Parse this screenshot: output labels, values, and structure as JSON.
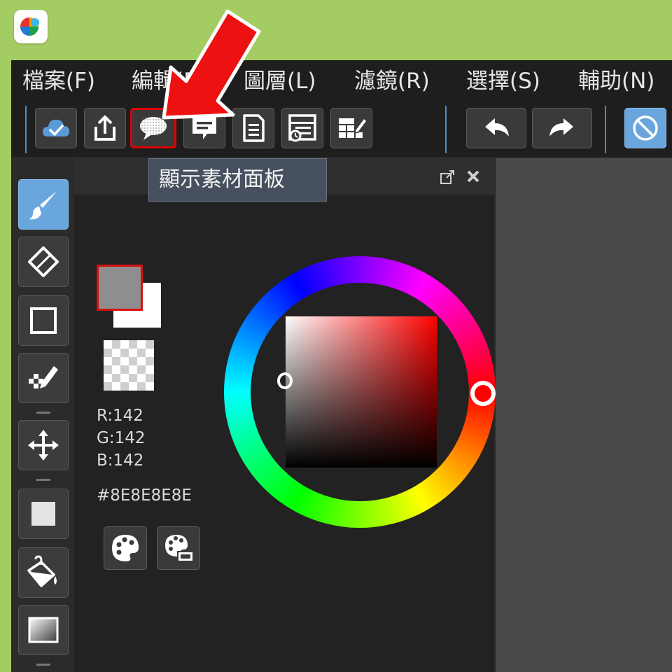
{
  "menu": [
    {
      "label": "檔案(F)"
    },
    {
      "label": "編輯(E)"
    },
    {
      "label": "圖層(L)"
    },
    {
      "label": "濾鏡(R)"
    },
    {
      "label": "選擇(S)"
    },
    {
      "label": "輔助(N)"
    }
  ],
  "toolbar": {
    "buttons": [
      {
        "icon": "cloud-check-icon"
      },
      {
        "icon": "upload-icon"
      },
      {
        "icon": "material-panel-icon",
        "highlighted": true
      },
      {
        "icon": "comment-icon"
      },
      {
        "icon": "page-icon"
      },
      {
        "icon": "layer-list-icon"
      },
      {
        "icon": "edit-grid-icon"
      },
      {
        "icon": "undo-icon"
      },
      {
        "icon": "redo-icon"
      },
      {
        "icon": "no-entry-icon"
      }
    ]
  },
  "tooltip": {
    "text": "顯示素材面板"
  },
  "color_panel": {
    "foreground": "#8E8E8E",
    "background": "#FFFFFF",
    "r": "R:142",
    "g": "G:142",
    "b": "B:142",
    "hex": "#8E8E8E8E",
    "hue": "#ff0000"
  },
  "colors": {
    "app_bg": "#a3cd62",
    "accent": "#6aa6de",
    "highlight": "#e00000"
  }
}
